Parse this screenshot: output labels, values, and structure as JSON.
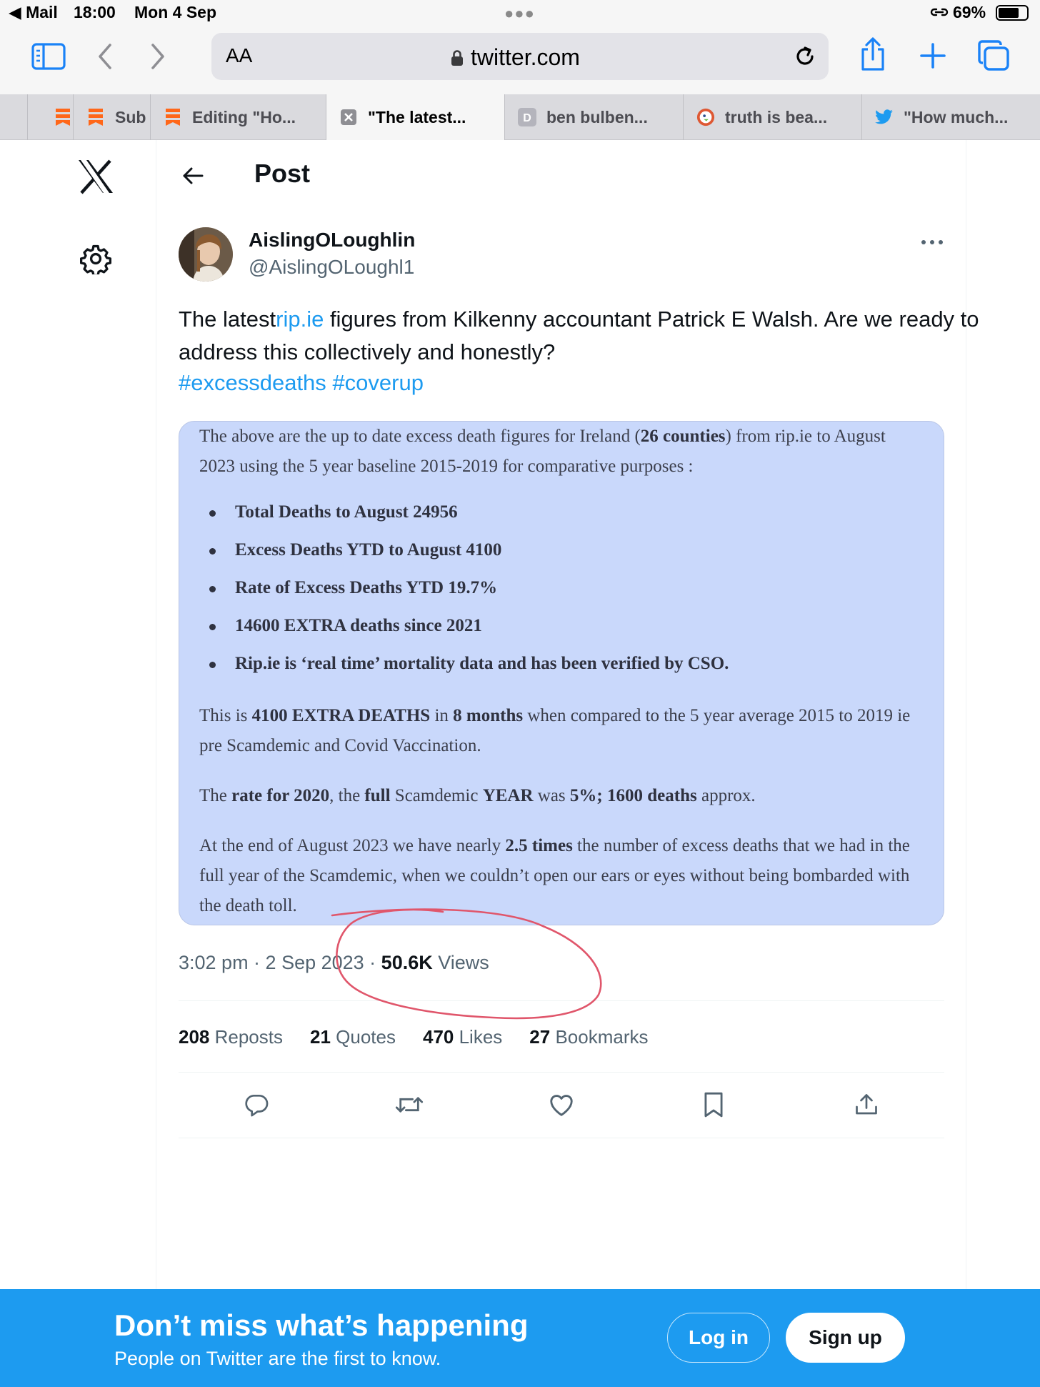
{
  "status_bar": {
    "back_app": "◀ Mail",
    "time": "18:00",
    "date": "Mon 4 Sep",
    "battery": "69%"
  },
  "safari": {
    "text_size_label": "AA",
    "domain": "twitter.com"
  },
  "tabs": [
    {
      "label": ""
    },
    {
      "label": "Sub"
    },
    {
      "label": "Editing \"Ho..."
    },
    {
      "label": "\"The latest..."
    },
    {
      "label": "ben bulben..."
    },
    {
      "label": "truth is bea..."
    },
    {
      "label": "\"How much..."
    }
  ],
  "header": {
    "title": "Post"
  },
  "tweet": {
    "display_name": "AislingOLoughlin",
    "handle": "@AislingOLoughl1",
    "text_before_link": "The latest",
    "link": "rip.ie",
    "text_after_link": " figures from Kilkenny accountant Patrick E Walsh. Are we ready to address this collectively and honestly?",
    "hashtag_1": "#excessdeaths",
    "hashtag_2": "#coverup",
    "time": "3:02 pm · 2 Sep 2023 · ",
    "views_count": "50.6K",
    "views_label": " Views"
  },
  "image_text": {
    "intro_1": "The above are the up to date excess death figures for Ireland (",
    "intro_bold": "26 counties",
    "intro_2": ") from rip.ie to August 2023 using the 5 year baseline 2015-2019 for comparative purposes :",
    "bullets": [
      "Total Deaths to August 24956",
      "Excess Deaths YTD to August 4100",
      "Rate of Excess Deaths YTD 19.7%",
      "14600 EXTRA deaths since 2021",
      "Rip.ie is ‘real time’ mortality data and has been verified by CSO."
    ],
    "p2_a": "This is ",
    "p2_b": "4100 EXTRA DEATHS",
    "p2_c": " in ",
    "p2_d": "8 months",
    "p2_e": " when compared to the 5 year average 2015 to 2019 ie pre Scamdemic and Covid Vaccination.",
    "p3_a": "The ",
    "p3_b": "rate for 2020",
    "p3_c": ", the ",
    "p3_d": "full",
    "p3_e": " Scamdemic ",
    "p3_f": "YEAR",
    "p3_g": " was ",
    "p3_h": "5%; 1600 deaths",
    "p3_i": " approx.",
    "p4_a": "At the end of August 2023 we have nearly ",
    "p4_b": "2.5 times",
    "p4_c": " the number of excess deaths that we had in the full year of the Scamdemic, when we couldn’t open our ears or eyes without being bombarded with the death toll."
  },
  "stats": {
    "reposts_count": "208",
    "reposts_label": " Reposts",
    "quotes_count": "21",
    "quotes_label": " Quotes",
    "likes_count": "470",
    "likes_label": " Likes",
    "bookmarks_count": "27",
    "bookmarks_label": " Bookmarks"
  },
  "banner": {
    "headline": "Don’t miss what’s happening",
    "subtext": "People on Twitter are the first to know.",
    "login": "Log in",
    "signup": "Sign up"
  },
  "colors": {
    "accent": "#1d9bf0",
    "image_bg": "#c9d8fb",
    "annotation": "#e0566b"
  }
}
